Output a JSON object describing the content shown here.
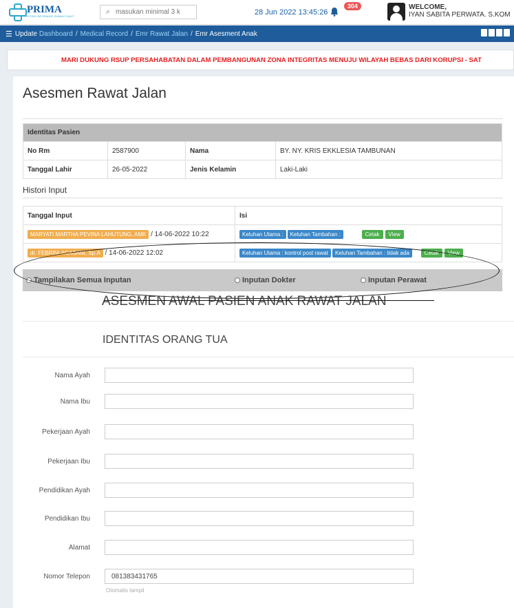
{
  "header": {
    "logo_text": "PRIMA",
    "logo_sub": "SISTEM INFORMASI RUMAH SAKIT",
    "search_placeholder": "masukan minimal 3 k",
    "datetime": "28 Jun 2022 13:45:26",
    "notification_count": "304",
    "welcome_label": "WELCOME,",
    "user_name": "IYAN SABITA PERWATA. S.KOM"
  },
  "breadcrumb": {
    "first": "Update",
    "items": [
      "Dashboard",
      "Medical Record",
      "Emr Rawat Jalan"
    ],
    "active": "Emr Asesment Anak"
  },
  "marquee_text": "MARI DUKUNG RSUP PERSAHABATAN DALAM PEMBANGUNAN ZONA INTEGRITAS MENUJU WILAYAH BEBAS DARI KORUPSI - SAT",
  "page_title": "Asesmen Rawat Jalan",
  "identitas": {
    "header": "Identitas Pasien",
    "no_rm_label": "No Rm",
    "no_rm": "2587900",
    "nama_label": "Nama",
    "nama": "BY. NY. KRIS EKKLESIA TAMBUNAN",
    "tgl_lahir_label": "Tanggal Lahir",
    "tgl_lahir": "26-05-2022",
    "jk_label": "Jenis Kelamin",
    "jk": "Laki-Laki"
  },
  "histori": {
    "label": "Histori Input",
    "col_tanggal": "Tanggal Input",
    "col_isi": "Isi",
    "rows": [
      {
        "user": "MARYATI MARTHA PEVINA LAHUTUNG, AMK",
        "date": "/ 14-06-2022 10:22",
        "keluhan_utama": "Keluhan Utama :",
        "keluhan_tambahan": "Keluhan Tambahan :",
        "cetak": "Cetak",
        "view": "View"
      },
      {
        "user": "dr. FEBRINI AGASANI, Sp.A",
        "date": "/ 14-06-2022 12:02",
        "keluhan_utama": "Keluhan Utama : kontrol post rawat",
        "keluhan_tambahan": "Keluhan Tambahan : tidak ada",
        "cetak": "Cetak",
        "view": "View"
      }
    ]
  },
  "filter": {
    "all": "Tampilakan Semua Inputan",
    "dokter": "Inputan Dokter",
    "perawat": "Inputan Perawat"
  },
  "form": {
    "title": "ASESMEN AWAL PASIEN ANAK RAWAT JALAN",
    "section": "IDENTITAS ORANG TUA",
    "fields": [
      {
        "label": "Nama Ayah",
        "value": ""
      },
      {
        "label": "Nama Ibu",
        "value": ""
      },
      {
        "label": "Pekerjaan Ayah",
        "value": ""
      },
      {
        "label": "Pekerjaan Ibu",
        "value": ""
      },
      {
        "label": "Pendidikan Ayah",
        "value": ""
      },
      {
        "label": "Pendidikan Ibu",
        "value": ""
      },
      {
        "label": "Alamat",
        "value": ""
      },
      {
        "label": "Nomor Telepon",
        "value": "081383431765"
      }
    ],
    "phone_hint": "Otomatis tampil"
  }
}
